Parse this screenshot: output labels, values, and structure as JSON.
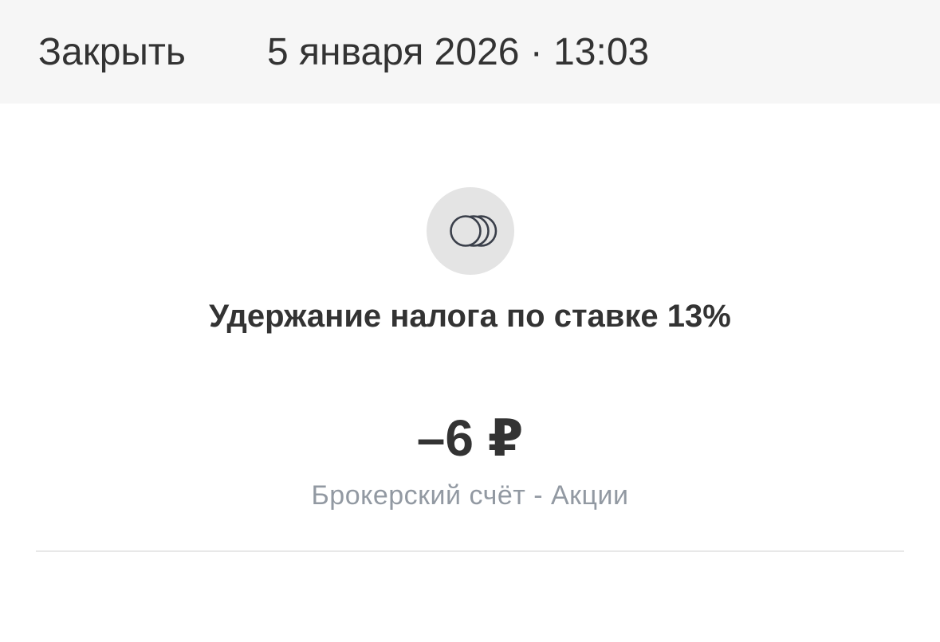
{
  "header": {
    "close_label": "Закрыть",
    "datetime": "5 января 2026 · 13:03"
  },
  "operation": {
    "icon": "coins-icon",
    "title": "Удержание налога по ставке 13%",
    "amount": "–6 ₽",
    "account": "Брокерский счёт - Акции"
  },
  "colors": {
    "header_bg": "#f6f6f6",
    "text_primary": "#333333",
    "text_secondary": "#9299a2",
    "icon_bg": "#e4e4e4",
    "icon_stroke": "#3a3f4a"
  }
}
